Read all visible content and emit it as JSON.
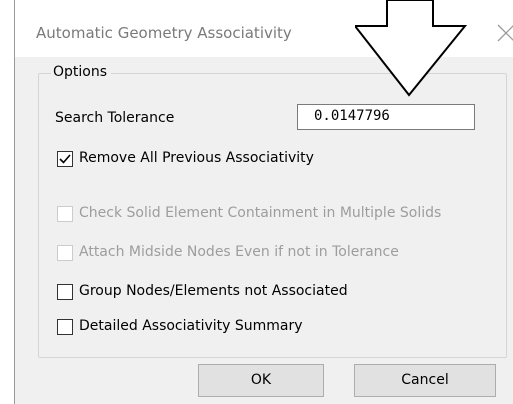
{
  "window": {
    "title": "Automatic Geometry Associativity"
  },
  "options_group": {
    "legend": "Options",
    "search_tolerance": {
      "label": "Search Tolerance",
      "value": "0.0147796"
    },
    "checkboxes": [
      {
        "label": "Remove All Previous Associativity",
        "checked": true,
        "enabled": true
      },
      {
        "label": "Check Solid Element Containment in Multiple Solids",
        "checked": false,
        "enabled": false
      },
      {
        "label": "Attach Midside Nodes Even if not in Tolerance",
        "checked": false,
        "enabled": false
      },
      {
        "label": "Group Nodes/Elements not Associated",
        "checked": false,
        "enabled": true
      },
      {
        "label": "Detailed Associativity Summary",
        "checked": false,
        "enabled": true
      }
    ]
  },
  "buttons": {
    "ok": "OK",
    "cancel": "Cancel"
  },
  "icons": {
    "close": "close-icon",
    "overlay": "down-arrow-icon"
  }
}
